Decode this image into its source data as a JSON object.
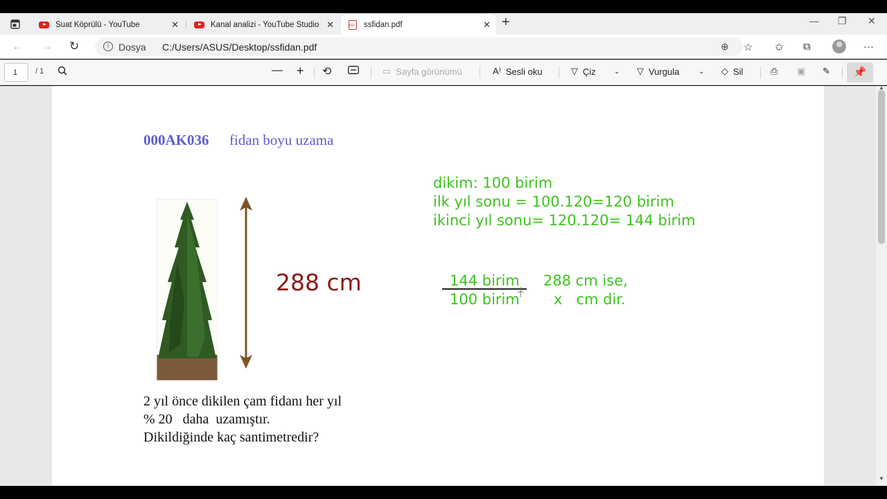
{
  "tabs": [
    {
      "label": "Suat Köprülü - YouTube",
      "icon": "youtube-icon"
    },
    {
      "label": "Kanal analizi - YouTube Studio",
      "icon": "youtube-icon"
    },
    {
      "label": "ssfidan.pdf",
      "icon": "pdf-icon"
    }
  ],
  "address": {
    "security_label": "Dosya",
    "url": "C:/Users/ASUS/Desktop/ssfidan.pdf"
  },
  "pdf_toolbar": {
    "page_current": "1",
    "page_total": "/ 1",
    "page_view": "Sayfa görünümü",
    "read_aloud": "Sesli oku",
    "draw": "Çiz",
    "highlight": "Vurgula",
    "erase": "Sil"
  },
  "document": {
    "code": "000AK036",
    "title": "fidan boyu uzama",
    "height_label": "288 cm",
    "question": [
      "2 yıl önce dikilen çam fidanı her yıl",
      "% 20   daha  uzamıştır.",
      "Dikildiğinde kaç santimetredir?"
    ],
    "notes": [
      "dikim: 100 birim",
      "ilk yıl sonu = 100.120=120 birim",
      "ikinci yıl sonu= 120.120= 144 birim"
    ],
    "fraction": {
      "top_left": "144 birim",
      "bottom_left": "100 birim",
      "top_right": "288 cm ise,",
      "bottom_right": "x   cm dir."
    }
  },
  "colors": {
    "title_blue": "#5e5ecf",
    "note_green": "#3ec21f",
    "height_red": "#8b1a1a"
  }
}
